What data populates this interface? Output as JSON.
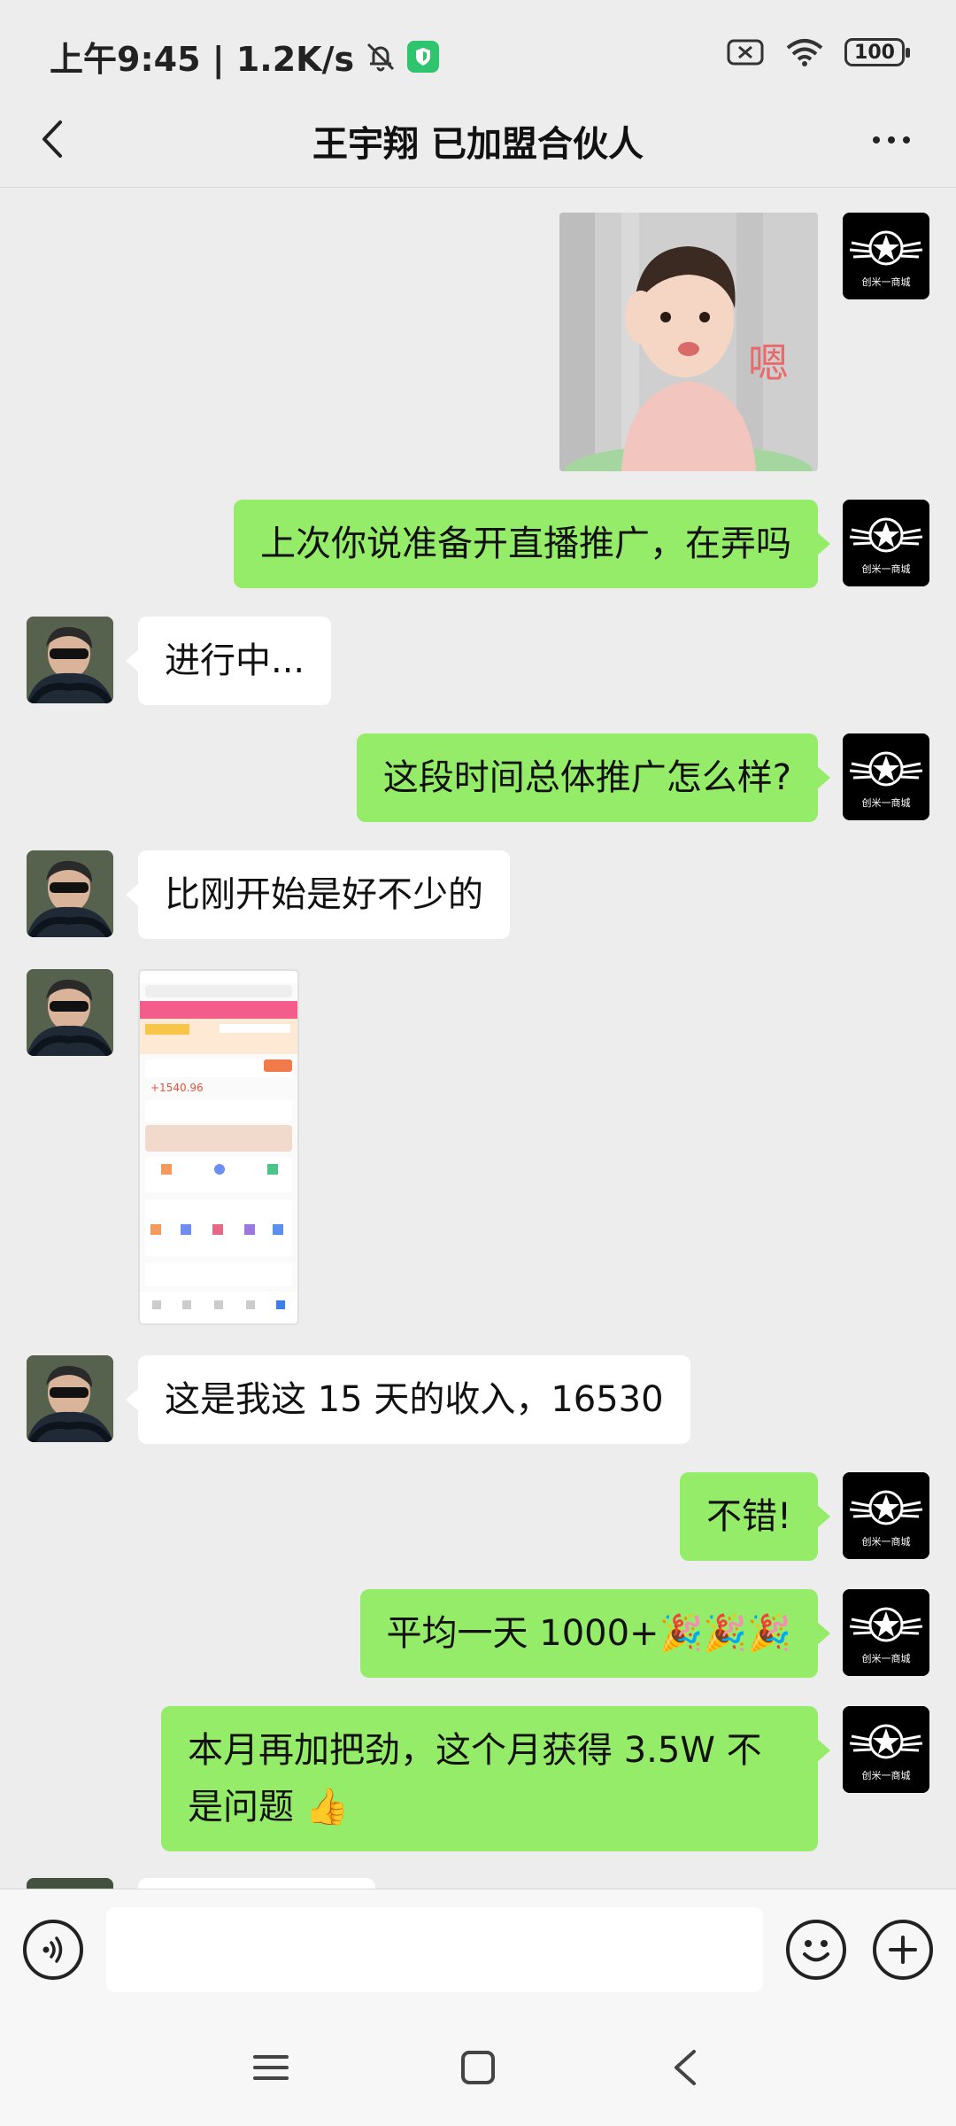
{
  "status_bar": {
    "time_speed": "上午9:45 | 1.2K/s",
    "battery": "100",
    "icons": [
      "mute-bell-icon",
      "shield-icon",
      "sim-icon",
      "wifi-icon",
      "battery-icon"
    ]
  },
  "header": {
    "title": "王宇翔 已加盟合伙人",
    "back_icon": "chevron-left-icon",
    "more_icon": "more-dots-icon"
  },
  "messages": [
    {
      "side": "right",
      "type": "sticker",
      "text": "嗯"
    },
    {
      "side": "right",
      "type": "text",
      "text": "上次你说准备开直播推广，在弄吗"
    },
    {
      "side": "left",
      "type": "text",
      "text": "进行中..."
    },
    {
      "side": "right",
      "type": "text",
      "text": "这段时间总体推广怎么样?"
    },
    {
      "side": "left",
      "type": "text",
      "text": "比刚开始是好不少的"
    },
    {
      "side": "left",
      "type": "image",
      "text": "+1540.96"
    },
    {
      "side": "left",
      "type": "text",
      "text": "这是我这 15 天的收入，16530"
    },
    {
      "side": "right",
      "type": "text",
      "text": "不错!"
    },
    {
      "side": "right",
      "type": "text",
      "text": "平均一天 1000+🎉🎉🎉"
    },
    {
      "side": "right",
      "type": "text",
      "text": "本月再加把劲，这个月获得 3.5W 不是问题 👍"
    }
  ],
  "self_avatar_label": "创米一商城",
  "input_bar": {
    "value": "",
    "voice_icon": "voice-icon",
    "emoji_icon": "emoji-icon",
    "plus_icon": "plus-icon"
  },
  "nav_bar": {
    "icons": [
      "menu-icon",
      "home-square-icon",
      "back-triangle-icon"
    ]
  },
  "colors": {
    "background": "#ededed",
    "self_bubble": "#95ec69",
    "other_bubble": "#ffffff",
    "shield": "#2fc46e"
  }
}
